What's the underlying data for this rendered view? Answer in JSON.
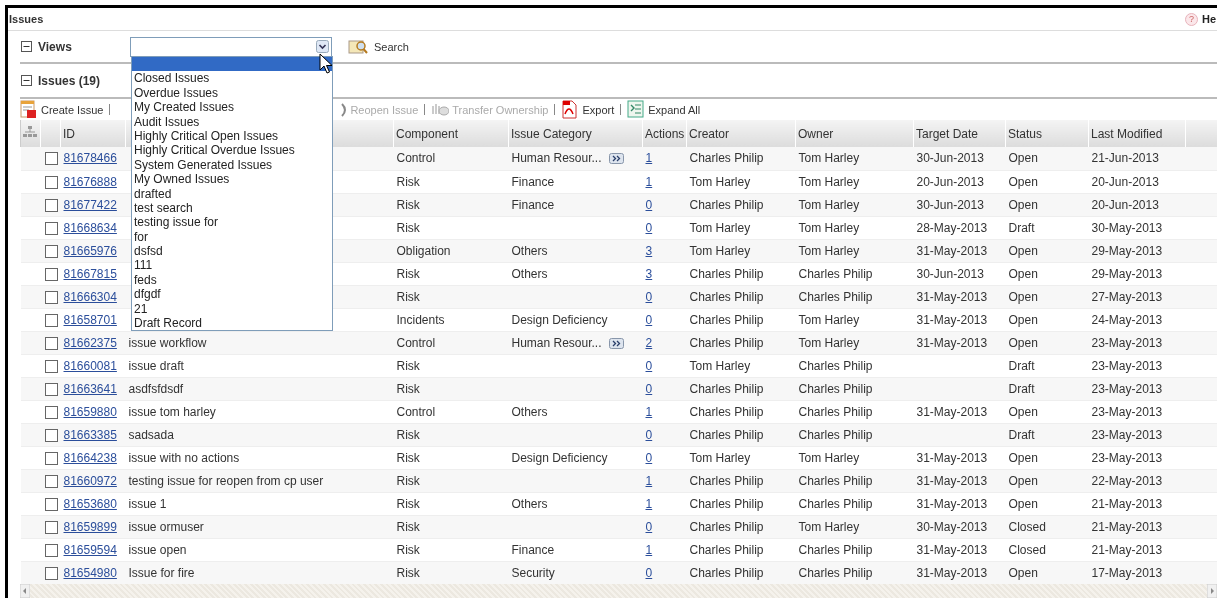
{
  "page_title": "Issues",
  "help": {
    "icon": "?",
    "label": "He"
  },
  "views": {
    "title": "Views",
    "collapsed": false,
    "blank_option_highlighted": true,
    "options": [
      {
        "label": "Closed Issues",
        "selected": false
      },
      {
        "label": "Overdue Issues",
        "selected": false
      },
      {
        "label": "My Created Issues",
        "selected": false
      },
      {
        "label": "Audit Issues",
        "selected": false
      },
      {
        "label": "Highly Critical Open Issues",
        "selected": false
      },
      {
        "label": "Highly Critical Overdue Issues",
        "selected": false
      },
      {
        "label": "System Generated Issues",
        "selected": false
      },
      {
        "label": "My Owned Issues",
        "selected": false
      },
      {
        "label": "drafted",
        "selected": false
      },
      {
        "label": "test search",
        "selected": false
      },
      {
        "label": "testing issue for",
        "selected": false
      },
      {
        "label": "for",
        "selected": false
      },
      {
        "label": "dsfsd",
        "selected": false
      },
      {
        "label": "111",
        "selected": false
      },
      {
        "label": "feds",
        "selected": false
      },
      {
        "label": "dfgdf",
        "selected": false
      },
      {
        "label": "21",
        "selected": false
      },
      {
        "label": "Draft Record",
        "selected": false
      }
    ],
    "search_label": "Search"
  },
  "issues": {
    "title": "Issues (19)",
    "collapsed": false,
    "toolbar": [
      {
        "kind": "create",
        "label": "Create Issue",
        "disabled": false
      },
      {
        "kind": "reopen",
        "label": "Reopen Issue",
        "disabled": true
      },
      {
        "kind": "transfer",
        "label": "Transfer Ownership",
        "disabled": true
      },
      {
        "kind": "export",
        "label": "Export",
        "disabled": false
      },
      {
        "kind": "expand",
        "label": "Expand All",
        "disabled": false
      }
    ],
    "columns": [
      "ID",
      "Component",
      "Issue Category",
      "Actions",
      "Creator",
      "Owner",
      "Target Date",
      "Status",
      "Last Modified"
    ],
    "rows": [
      {
        "id": "81678466",
        "component": "Control",
        "category": "Human Resour...",
        "more": true,
        "actions": "1",
        "creator": "Charles Philip",
        "owner": "Tom Harley",
        "target_date": "30-Jun-2013",
        "status": "Open",
        "last_modified": "21-Jun-2013",
        "checked": false
      },
      {
        "id": "81676888",
        "component": "Risk",
        "category": "Finance",
        "more": false,
        "actions": "1",
        "creator": "Tom Harley",
        "owner": "Tom Harley",
        "target_date": "20-Jun-2013",
        "status": "Open",
        "last_modified": "20-Jun-2013",
        "checked": false
      },
      {
        "id": "81677422",
        "component": "Risk",
        "category": "Finance",
        "more": false,
        "actions": "0",
        "creator": "Charles Philip",
        "owner": "Tom Harley",
        "target_date": "30-Jun-2013",
        "status": "Open",
        "last_modified": "20-Jun-2013",
        "checked": false
      },
      {
        "id": "81668634",
        "component": "Risk",
        "more": false,
        "actions": "0",
        "creator": "Tom Harley",
        "owner": "Tom Harley",
        "target_date": "28-May-2013",
        "status": "Draft",
        "last_modified": "30-May-2013",
        "checked": false
      },
      {
        "id": "81665976",
        "component": "Obligation",
        "category": "Others",
        "more": false,
        "actions": "3",
        "creator": "Tom Harley",
        "owner": "Tom Harley",
        "target_date": "31-May-2013",
        "status": "Open",
        "last_modified": "29-May-2013",
        "checked": false
      },
      {
        "id": "81667815",
        "component": "Risk",
        "category": "Others",
        "more": false,
        "actions": "3",
        "creator": "Charles Philip",
        "owner": "Charles Philip",
        "target_date": "30-Jun-2013",
        "status": "Open",
        "last_modified": "29-May-2013",
        "checked": false
      },
      {
        "id": "81666304",
        "component": "Risk",
        "more": false,
        "actions": "0",
        "creator": "Charles Philip",
        "owner": "Charles Philip",
        "target_date": "31-May-2013",
        "status": "Open",
        "last_modified": "27-May-2013",
        "checked": false
      },
      {
        "id": "81658701",
        "component": "Incidents",
        "category": "Design Deficiency",
        "more": false,
        "actions": "0",
        "creator": "Charles Philip",
        "owner": "Tom Harley",
        "target_date": "31-May-2013",
        "status": "Open",
        "last_modified": "24-May-2013",
        "checked": false
      },
      {
        "id": "81662375",
        "title": "issue workflow",
        "component": "Control",
        "category": "Human Resour...",
        "more": true,
        "actions": "2",
        "creator": "Charles Philip",
        "owner": "Tom Harley",
        "target_date": "31-May-2013",
        "status": "Open",
        "last_modified": "23-May-2013",
        "checked": false
      },
      {
        "id": "81660081",
        "title": "issue draft",
        "component": "Risk",
        "more": false,
        "actions": "0",
        "creator": "Tom Harley",
        "owner": "Charles Philip",
        "status": "Draft",
        "last_modified": "23-May-2013",
        "checked": false
      },
      {
        "id": "81663641",
        "title": "asdfsfdsdf",
        "component": "Risk",
        "more": false,
        "actions": "0",
        "creator": "Charles Philip",
        "owner": "Charles Philip",
        "status": "Draft",
        "last_modified": "23-May-2013",
        "checked": false
      },
      {
        "id": "81659880",
        "title": "issue tom harley",
        "component": "Control",
        "category": "Others",
        "more": false,
        "actions": "1",
        "creator": "Charles Philip",
        "owner": "Charles Philip",
        "target_date": "31-May-2013",
        "status": "Open",
        "last_modified": "23-May-2013",
        "checked": false
      },
      {
        "id": "81663385",
        "title": "sadsada",
        "component": "Risk",
        "more": false,
        "actions": "0",
        "creator": "Charles Philip",
        "owner": "Charles Philip",
        "status": "Draft",
        "last_modified": "23-May-2013",
        "checked": false
      },
      {
        "id": "81664238",
        "title": "issue with no actions",
        "component": "Risk",
        "category": "Design Deficiency",
        "more": false,
        "actions": "0",
        "creator": "Tom Harley",
        "owner": "Tom Harley",
        "target_date": "31-May-2013",
        "status": "Open",
        "last_modified": "23-May-2013",
        "checked": false
      },
      {
        "id": "81660972",
        "title": "testing issue for reopen from cp user",
        "component": "Risk",
        "more": false,
        "actions": "1",
        "creator": "Charles Philip",
        "owner": "Charles Philip",
        "target_date": "31-May-2013",
        "status": "Open",
        "last_modified": "22-May-2013",
        "checked": false
      },
      {
        "id": "81653680",
        "title": "issue 1",
        "component": "Risk",
        "category": "Others",
        "more": false,
        "actions": "1",
        "creator": "Charles Philip",
        "owner": "Charles Philip",
        "target_date": "31-May-2013",
        "status": "Open",
        "last_modified": "21-May-2013",
        "checked": false
      },
      {
        "id": "81659899",
        "title": "issue ormuser",
        "component": "Risk",
        "more": false,
        "actions": "0",
        "creator": "Charles Philip",
        "owner": "Tom Harley",
        "target_date": "30-May-2013",
        "status": "Closed",
        "last_modified": "21-May-2013",
        "checked": false
      },
      {
        "id": "81659594",
        "title": "issue open",
        "component": "Risk",
        "category": "Finance",
        "more": false,
        "actions": "1",
        "creator": "Charles Philip",
        "owner": "Charles Philip",
        "target_date": "31-May-2013",
        "status": "Closed",
        "last_modified": "21-May-2013",
        "checked": false
      },
      {
        "id": "81654980",
        "title": "Issue for fire",
        "component": "Risk",
        "category": "Security",
        "more": false,
        "actions": "0",
        "creator": "Charles Philip",
        "owner": "Charles Philip",
        "target_date": "31-May-2013",
        "status": "Open",
        "last_modified": "17-May-2013",
        "checked": false
      }
    ]
  }
}
